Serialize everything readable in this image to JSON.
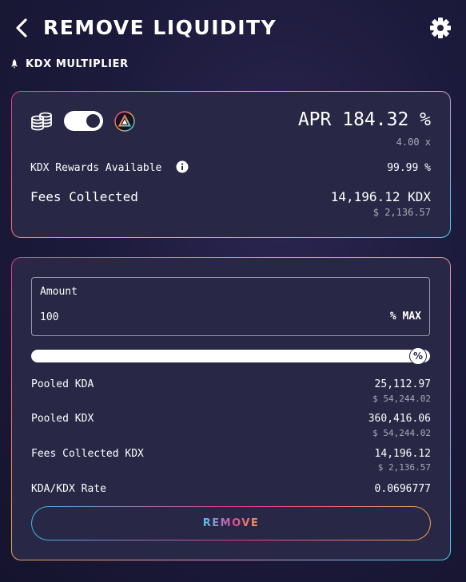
{
  "header": {
    "title": "REMOVE LIQUIDITY"
  },
  "subheader": {
    "label": "KDX MULTIPLIER"
  },
  "rewards_card": {
    "toggle_on": true,
    "apr_label": "APR 184.32 %",
    "multiplier": "4.00 x",
    "rewards_available_label": "KDX Rewards Available",
    "rewards_available_value": "99.99 %",
    "fees_collected_label": "Fees Collected",
    "fees_collected_value": "14,196.12 KDX",
    "fees_collected_usd": "$ 2,136.57"
  },
  "liquidity_card": {
    "amount_label": "Amount",
    "amount_value": "100",
    "amount_suffix": "% MAX",
    "slider_percent": 100,
    "slider_thumb_label": "%",
    "rows": [
      {
        "label": "Pooled KDA",
        "value": "25,112.97",
        "usd": "$ 54,244.02"
      },
      {
        "label": "Pooled KDX",
        "value": "360,416.06",
        "usd": "$ 54,244.02"
      },
      {
        "label": "Fees Collected KDX",
        "value": "14,196.12",
        "usd": "$ 2,136.57"
      },
      {
        "label": "KDA/KDX Rate",
        "value": "0.0696777",
        "usd": ""
      }
    ],
    "remove_label": "REMOVE"
  },
  "colors": {
    "card_bg": "#282846",
    "accent_pink": "#e6388f",
    "accent_orange": "#f3a14a",
    "accent_cyan": "#3fd0ea"
  },
  "icons": [
    "back-chevron-icon",
    "gear-icon",
    "rocket-icon",
    "coin-stack-icon",
    "kaddex-logo-icon",
    "info-icon"
  ]
}
